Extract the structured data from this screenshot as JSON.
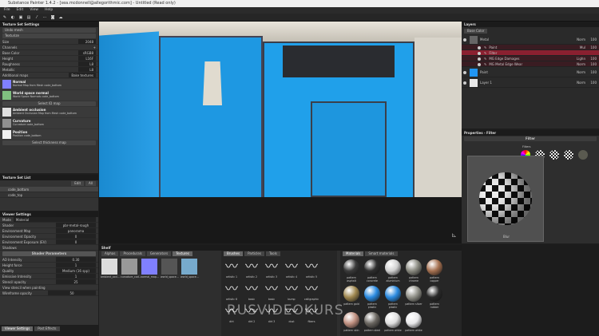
{
  "window": {
    "title": "Substance Painter 1.4.2 - [sea.mcdonnell@allegorithmic.com] - Untitled (Read only)"
  },
  "menu": [
    "File",
    "Edit",
    "View",
    "Help"
  ],
  "texture_set_settings": {
    "title": "Texture Set Settings",
    "btn1": "Undo mesh",
    "btn2": "Texturize",
    "size_label": "Size",
    "size_value": "2048",
    "channels_label": "Channels",
    "channels": [
      {
        "name": "Base Color",
        "format": "sRGB8"
      },
      {
        "name": "Height",
        "format": "L16F"
      },
      {
        "name": "Roughness",
        "format": "L8"
      },
      {
        "name": "Metallic",
        "format": "L8"
      }
    ],
    "additional_maps": "Additional maps",
    "bake_textures": "Bake textures",
    "maps": [
      {
        "name": "Normal",
        "desc": "Normal Map from Mesh code_bottom",
        "color": "#8080ff"
      },
      {
        "name": "World space normal",
        "desc": "World Space Normals code_bottom",
        "color": "#80c080"
      }
    ],
    "select_id": "Select ID map",
    "maps2": [
      {
        "name": "Ambient occlusion",
        "desc": "Ambient Occlusion Map from Mesh code_bottom",
        "color": "#e0e0e0"
      },
      {
        "name": "Curvature",
        "desc": "Curvature code_bottom",
        "color": "#909090"
      },
      {
        "name": "Position",
        "desc": "Position code_bottom",
        "color": "#f0f0f0"
      }
    ],
    "select_thickness": "Select thickness map"
  },
  "texture_set_list": {
    "title": "Texture Set List",
    "edit": "Edit",
    "all": "All",
    "items": [
      "code_bottom",
      "code_top"
    ]
  },
  "viewer_settings": {
    "title": "Viewer Settings",
    "mode_label": "Mode",
    "mode": "Material",
    "rows": [
      {
        "label": "Shader",
        "value": "pbr-metal-rough"
      },
      {
        "label": "Environment Map",
        "value": "panorama"
      },
      {
        "label": "Environment Opacity",
        "value": "0"
      },
      {
        "label": "Environment Exposure (EV)",
        "value": "0"
      }
    ],
    "shadows": "Shadows",
    "shader_params": "Shader Parameters",
    "params": [
      {
        "label": "AO Intensity",
        "value": "0.30"
      },
      {
        "label": "Height force",
        "value": "1"
      },
      {
        "label": "Quality",
        "value": "Medium (16 spp)"
      },
      {
        "label": "Emissive Intensity",
        "value": "1"
      }
    ],
    "stencil_opacity": {
      "label": "Stencil opacity",
      "value": "25"
    },
    "view_stencil": "View stencil when painting",
    "wireframe": {
      "label": "Wireframe opacity",
      "value": "50"
    }
  },
  "left_tabs": [
    "Viewer Settings",
    "Post Effects"
  ],
  "layers": {
    "title": "Layers",
    "channel": "Base Color",
    "items": [
      {
        "name": "Metal",
        "blend": "Norm",
        "opacity": "100",
        "type": "folder"
      },
      {
        "name": "Paint",
        "blend": "Mul",
        "opacity": "100",
        "sub": true
      },
      {
        "name": "Filter",
        "blend": "",
        "opacity": "",
        "sub": true,
        "selected": true
      },
      {
        "name": "MG Edge Damages",
        "blend": "Lighn",
        "opacity": "100",
        "sub": true
      },
      {
        "name": "MG Metal Edge Wear",
        "blend": "Norm",
        "opacity": "100",
        "sub": true
      },
      {
        "name": "Paint",
        "blend": "Norm",
        "opacity": "100",
        "type": "fill",
        "color": "#2196f3"
      },
      {
        "name": "Layer 1",
        "blend": "Norm",
        "opacity": "100",
        "type": "fill",
        "color": "#e8e8e8"
      }
    ]
  },
  "properties": {
    "title": "Properties - Filter",
    "filter_header": "Filter",
    "filters_label": "Filters",
    "preview_label": "Blur"
  },
  "shelf": {
    "title": "Shelf",
    "tabs": [
      "Alphas",
      "Procedurals",
      "Generators",
      "Textures"
    ],
    "active_tab": 3,
    "textures": [
      {
        "label": "ambient_occl...",
        "color": "#ddd"
      },
      {
        "label": "curvature_cod...",
        "color": "#999"
      },
      {
        "label": "normal_map...",
        "color": "#8080ff"
      },
      {
        "label": "world_space...",
        "color": "#555"
      },
      {
        "label": "world_space...",
        "color": "#7ac"
      }
    ],
    "brush_tabs": [
      "Brushes",
      "Particles",
      "Tools"
    ],
    "brushes": [
      "artistic 1",
      "artistic 2",
      "artistic 3",
      "artistic 4",
      "artistic 5",
      "artistic 6",
      "basic",
      "basic",
      "bump",
      "calligraphic",
      "dirt",
      "dirt 2",
      "dirt 3",
      "dust",
      "fibers"
    ],
    "material_tabs": [
      "Materials",
      "Smart materials"
    ],
    "materials": [
      {
        "label": "pattern asphalt",
        "color": "#3a3a3a"
      },
      {
        "label": "pattern concrete",
        "color": "#2e2e2e"
      },
      {
        "label": "pattern aluminium",
        "color": "#d0d0d0"
      },
      {
        "label": "pattern chrome",
        "color": "#8a8a80"
      },
      {
        "label": "pattern copper",
        "color": "#a57050"
      },
      {
        "label": "pattern gold",
        "color": "#a08850"
      },
      {
        "label": "pattern plastic",
        "color": "#2a8ae0"
      },
      {
        "label": "pattern plastic",
        "color": "#2a8ae0"
      },
      {
        "label": "pattern silver",
        "color": "#909088"
      },
      {
        "label": "pattern rubber",
        "color": "#2a2a2a"
      },
      {
        "label": "pattern skin",
        "color": "#c09080"
      },
      {
        "label": "pattern steel",
        "color": "#6a6660"
      },
      {
        "label": "pattern white",
        "color": "#e0e0e0"
      },
      {
        "label": "pattern white",
        "color": "#e8e8ea"
      }
    ]
  },
  "watermark": "RUSVIDEOKURS",
  "colors": {
    "accent_selected": "#8a2030",
    "model_blue": "#1e9ae0"
  }
}
